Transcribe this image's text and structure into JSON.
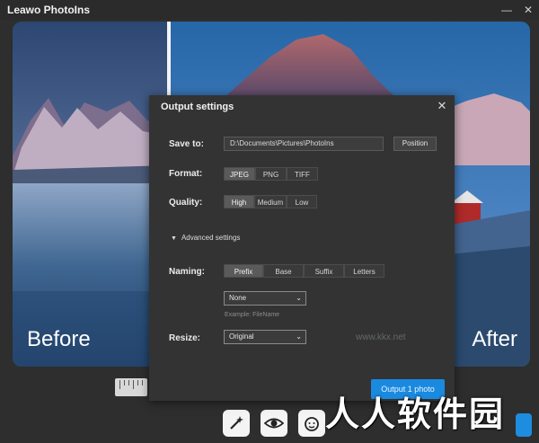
{
  "app": {
    "title": "Leawo PhotoIns",
    "window_controls": [
      "—",
      "✕"
    ]
  },
  "preview": {
    "before_label": "Before",
    "after_label": "After"
  },
  "dialog": {
    "title": "Output settings",
    "close_glyph": "✕",
    "save_to": {
      "label": "Save to:",
      "path": "D:\\Documents\\Pictures\\PhotoIns",
      "position_button": "Position"
    },
    "format": {
      "label": "Format:",
      "options": [
        "JPEG",
        "PNG",
        "TIFF"
      ],
      "selected": "JPEG"
    },
    "quality": {
      "label": "Quality:",
      "options": [
        "High",
        "Medium",
        "Low"
      ],
      "selected": "High"
    },
    "advanced": {
      "label": "Advanced settings",
      "caret": "▼"
    },
    "naming": {
      "label": "Naming:",
      "options": [
        "Prefix",
        "Base",
        "Suffix",
        "Letters"
      ],
      "selected": "Prefix",
      "dropdown_value": "None",
      "example": "Example: FileName"
    },
    "resize": {
      "label": "Resize:",
      "dropdown_value": "Original"
    },
    "output_button": "Output 1 photo",
    "site_watermark": "www.kkx.net"
  },
  "toolbar": {
    "icons": [
      "magic-wand-icon",
      "eye-icon",
      "face-icon"
    ]
  },
  "watermark": "人人软件园",
  "colors": {
    "accent": "#1a8ae0",
    "dialog_bg": "#333333",
    "app_bg": "#2e2e2e"
  }
}
